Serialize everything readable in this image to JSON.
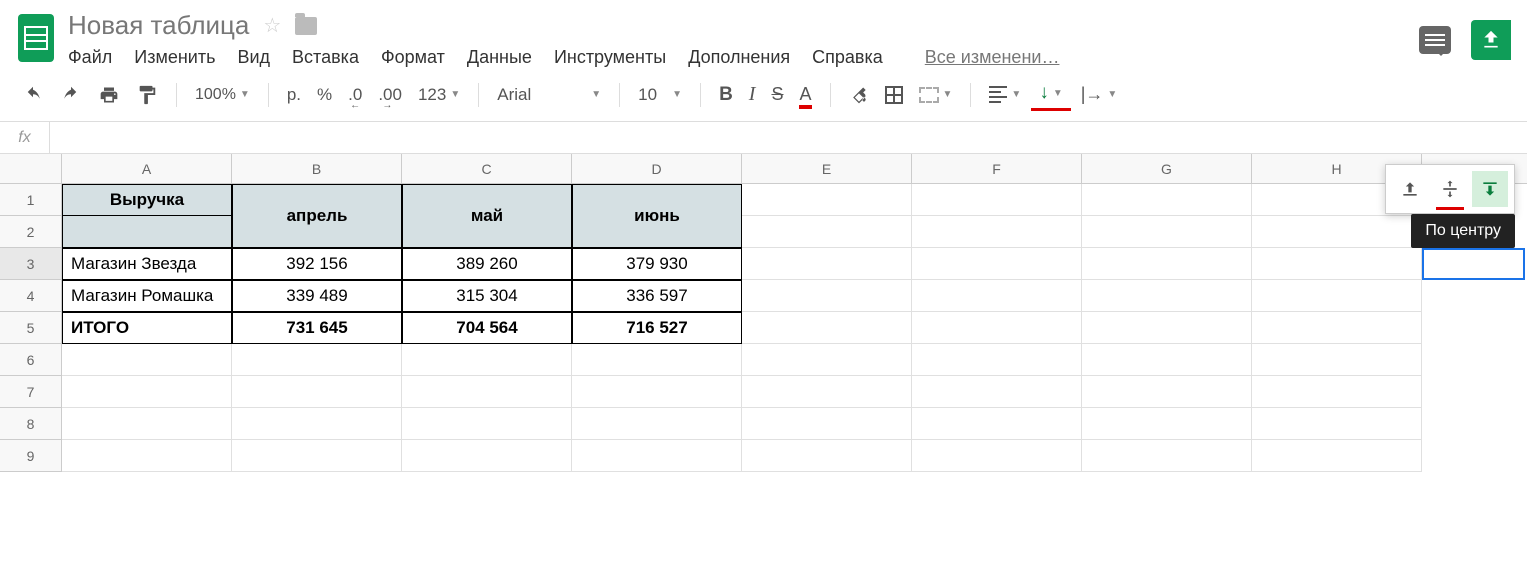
{
  "header": {
    "title": "Новая таблица",
    "menu": [
      "Файл",
      "Изменить",
      "Вид",
      "Вставка",
      "Формат",
      "Данные",
      "Инструменты",
      "Дополнения",
      "Справка"
    ],
    "changes": "Все изменени…"
  },
  "toolbar": {
    "zoom": "100%",
    "currency": "р.",
    "percent": "%",
    "dec_less": ".0",
    "dec_more": ".00",
    "format_123": "123",
    "font": "Arial",
    "font_size": "10",
    "bold": "B",
    "italic": "I",
    "strike": "S",
    "text_color": "A"
  },
  "columns": [
    "A",
    "B",
    "C",
    "D",
    "E",
    "F",
    "G",
    "H"
  ],
  "rows": [
    "1",
    "2",
    "3",
    "4",
    "5",
    "6",
    "7",
    "8",
    "9"
  ],
  "table": {
    "a1": "Выручка",
    "b12": "апрель",
    "c12": "май",
    "d12": "июнь",
    "a3": "Магазин Звезда",
    "b3": "392 156",
    "c3": "389 260",
    "d3": "379 930",
    "a4": "Магазин Ромашка",
    "b4": "339 489",
    "c4": "315 304",
    "d4": "336 597",
    "a5": "ИТОГО",
    "b5": "731 645",
    "c5": "704 564",
    "d5": "716 527"
  },
  "tooltip": "По центру",
  "fx": "fx"
}
